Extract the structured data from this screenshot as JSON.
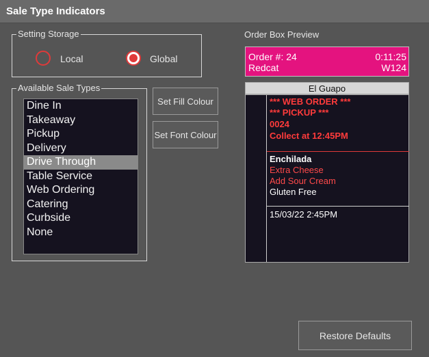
{
  "window": {
    "title": "Sale Type Indicators"
  },
  "setting_storage": {
    "label": "Setting Storage",
    "options": [
      {
        "label": "Local",
        "checked": false
      },
      {
        "label": "Global",
        "checked": true
      }
    ]
  },
  "sale_types": {
    "label": "Available Sale Types",
    "items": [
      "Dine In",
      "Takeaway",
      "Pickup",
      "Delivery",
      "Drive Through",
      "Table Service",
      "Web Ordering",
      "Catering",
      "Curbside",
      "None"
    ],
    "selected": "Drive Through"
  },
  "buttons": {
    "set_fill": "Set Fill Colour",
    "set_font": "Set Font Colour",
    "restore": "Restore Defaults"
  },
  "preview": {
    "label": "Order Box Preview",
    "order_number": "Order #: 24",
    "timer": "0:11:25",
    "store": "Redcat",
    "terminal": "W124",
    "customer": "El Guapo",
    "header_lines": [
      "*** WEB ORDER ***",
      "*** PICKUP ***",
      "0024",
      "Collect at 12:45PM"
    ],
    "item": {
      "name": "Enchilada",
      "modifiers": [
        "Extra Cheese",
        "Add Sour Cream"
      ],
      "note": "Gluten Free"
    },
    "footer_datetime": "15/03/22  2:45PM"
  },
  "colors": {
    "order_fill": "#e4137f",
    "radio_accent": "#e03a3a",
    "ticket_red": "#ff3b3b"
  }
}
